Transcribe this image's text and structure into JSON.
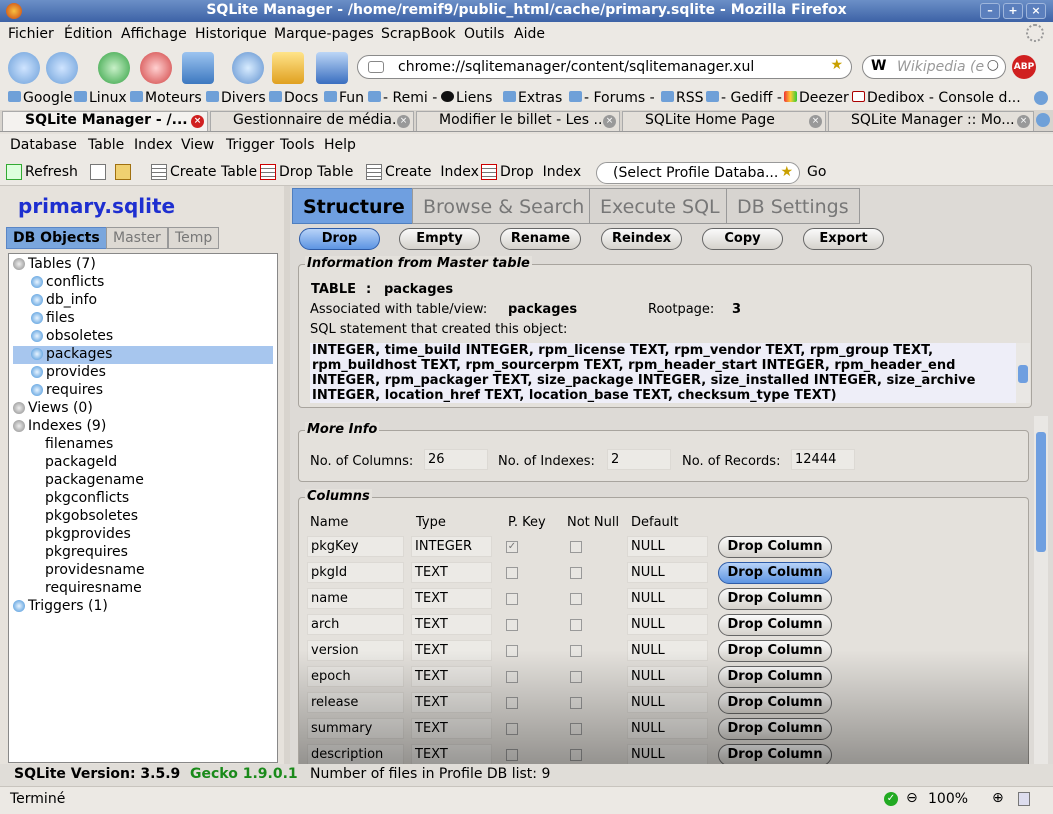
{
  "window": {
    "title": "SQLite Manager - /home/remif9/public_html/cache/primary.sqlite - Mozilla Firefox"
  },
  "ff_menu": [
    "Fichier",
    "Édition",
    "Affichage",
    "Historique",
    "Marque-pages",
    "ScrapBook",
    "Outils",
    "Aide"
  ],
  "url": "chrome://sqlitemanager/content/sqlitemanager.xul",
  "search_placeholder": "Wikipedia (e",
  "bookmarks": [
    "Google",
    "Linux",
    "Moteurs",
    "Divers",
    "Docs",
    "Fun",
    "- Remi -",
    "Liens",
    "Extras",
    "- Forums -",
    "RSS",
    "- Gediff -",
    "Deezer",
    "Dedibox - Console d..."
  ],
  "tabs": [
    "SQLite Manager - /...",
    "Gestionnaire de média...",
    "Modifier le billet - Les ...",
    "SQLite Home Page",
    "SQLite Manager :: Mo..."
  ],
  "app_menu": [
    "Database",
    "Table",
    "Index",
    "View",
    "Trigger",
    "Tools",
    "Help"
  ],
  "toolbar": {
    "refresh": "Refresh",
    "create_table": "Create Table",
    "drop_table": "Drop Table",
    "create_index": "Create  Index",
    "drop_index": "Drop  Index",
    "profile": "(Select Profile Databa...",
    "go": "Go"
  },
  "db": {
    "name": "primary.sqlite",
    "tabs": [
      "DB Objects",
      "Master",
      "Temp"
    ]
  },
  "tree": {
    "tables_label": "Tables (7)",
    "tables": [
      "conflicts",
      "db_info",
      "files",
      "obsoletes",
      "packages",
      "provides",
      "requires"
    ],
    "views_label": "Views (0)",
    "indexes_label": "Indexes (9)",
    "indexes": [
      "filenames",
      "packageId",
      "packagename",
      "pkgconflicts",
      "pkgobsoletes",
      "pkgprovides",
      "pkgrequires",
      "providesname",
      "requiresname"
    ],
    "triggers_label": "Triggers (1)",
    "selected": "packages"
  },
  "main_tabs": [
    "Structure",
    "Browse & Search",
    "Execute SQL",
    "DB Settings"
  ],
  "actions": [
    "Drop",
    "Empty",
    "Rename",
    "Reindex",
    "Copy",
    "Export"
  ],
  "master": {
    "title": "Information from Master table",
    "type": "TABLE",
    "sep": ":",
    "name": "packages",
    "assoc_label": "Associated with table/view:",
    "assoc": "packages",
    "rootpage_label": "Rootpage:",
    "rootpage": "3",
    "sql_label": "SQL statement that created this object:",
    "sql_lines": [
      "INTEGER,  time_build INTEGER,  rpm_license TEXT,  rpm_vendor TEXT,  rpm_group TEXT,",
      "rpm_buildhost TEXT,  rpm_sourcerpm TEXT,  rpm_header_start INTEGER,  rpm_header_end",
      "INTEGER,  rpm_packager TEXT,  size_package INTEGER,  size_installed INTEGER,  size_archive",
      "INTEGER,  location_href TEXT,  location_base TEXT,  checksum_type TEXT)"
    ]
  },
  "more_info": {
    "title": "More Info",
    "columns_label": "No. of Columns:",
    "columns": "26",
    "indexes_label": "No. of Indexes:",
    "indexes": "2",
    "records_label": "No. of Records:",
    "records": "12444"
  },
  "columns": {
    "title": "Columns",
    "headers": [
      "Name",
      "Type",
      "P. Key",
      "Not Null",
      "Default"
    ],
    "drop_label": "Drop Column",
    "rows": [
      {
        "name": "pkgKey",
        "type": "INTEGER",
        "pk": true,
        "default": "NULL"
      },
      {
        "name": "pkgId",
        "type": "TEXT",
        "pk": false,
        "default": "NULL"
      },
      {
        "name": "name",
        "type": "TEXT",
        "pk": false,
        "default": "NULL"
      },
      {
        "name": "arch",
        "type": "TEXT",
        "pk": false,
        "default": "NULL"
      },
      {
        "name": "version",
        "type": "TEXT",
        "pk": false,
        "default": "NULL"
      },
      {
        "name": "epoch",
        "type": "TEXT",
        "pk": false,
        "default": "NULL"
      },
      {
        "name": "release",
        "type": "TEXT",
        "pk": false,
        "default": "NULL"
      },
      {
        "name": "summary",
        "type": "TEXT",
        "pk": false,
        "default": "NULL"
      },
      {
        "name": "description",
        "type": "TEXT",
        "pk": false,
        "default": "NULL"
      }
    ]
  },
  "status_app": {
    "version": "SQLite Version: 3.5.9",
    "gecko": "Gecko 1.9.0.1",
    "files": "Number of files in Profile DB list: 9"
  },
  "status_ff": {
    "text": "Terminé",
    "zoom": "100%"
  }
}
